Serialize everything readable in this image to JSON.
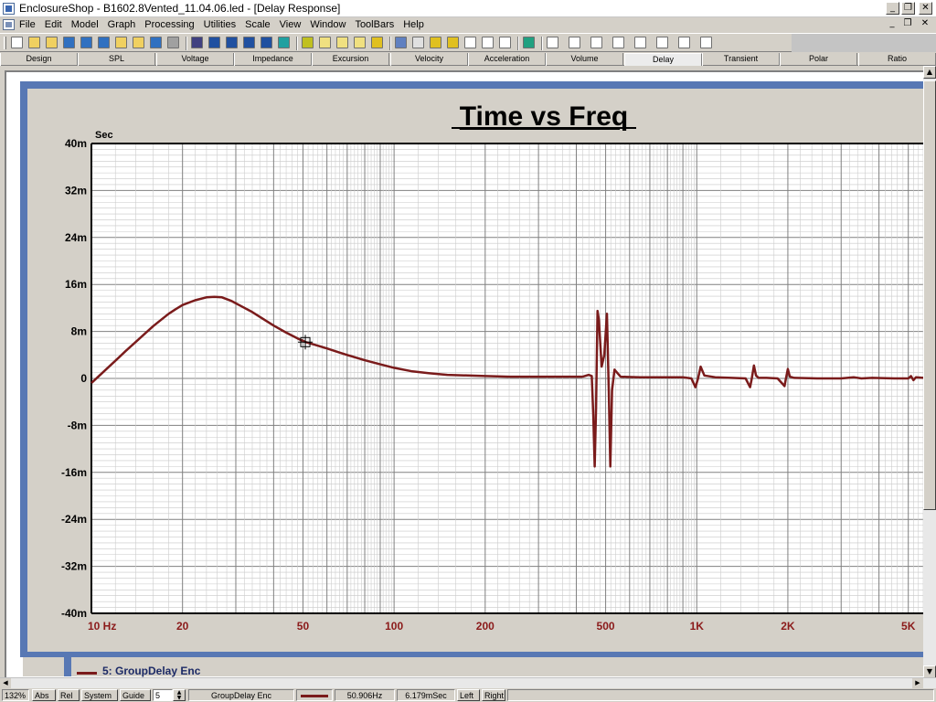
{
  "window": {
    "title": "EnclosureShop - B1602.8Vented_11.04.06.led - [Delay Response]"
  },
  "menu": [
    "File",
    "Edit",
    "Model",
    "Graph",
    "Processing",
    "Utilities",
    "Scale",
    "View",
    "Window",
    "ToolBars",
    "Help"
  ],
  "toolbar": {
    "icons": [
      "new-icon",
      "open-icon",
      "open-folder-icon",
      "save-icon",
      "save-as-icon",
      "save-all-icon",
      "folder-icon",
      "folder-open-icon",
      "save-disk-icon",
      "print-icon",
      "monitor-icon",
      "zoom-in-icon",
      "zoom-out-icon",
      "zoom-fit-icon",
      "zoom-region-icon",
      "grid-icon",
      "speaker-icon",
      "copy-icon",
      "export-icon",
      "graph-icon",
      "chart-icon",
      "bars-icon",
      "table-icon",
      "box-icon",
      "star-icon",
      "window-icon",
      "list-icon",
      "cascade-icon",
      "undo-icon",
      "brackets-icon",
      "mark-icon",
      "x-icon",
      "stack-icon",
      "multi-icon",
      "grid2-icon",
      "columns-icon",
      "panel-icon"
    ],
    "button_colors": [
      "#ffffff",
      "#f0d060",
      "#f0d060",
      "#3070c0",
      "#3070c0",
      "#3070c0",
      "#f0d060",
      "#f0d060",
      "#3070c0",
      "#a0a0a0",
      "#404080",
      "#2050a0",
      "#2050a0",
      "#2050a0",
      "#2050a0",
      "#20a0a0",
      "#c0c020",
      "#f0e080",
      "#f0e080",
      "#f0e080",
      "#e0c020",
      "#6080c0",
      "#e0e0e0",
      "#e0c020",
      "#e0c020",
      "#ffffff",
      "#ffffff",
      "#ffffff",
      "#20a080",
      "#ffffff",
      "#ffffff",
      "#ffffff",
      "#ffffff",
      "#ffffff",
      "#ffffff",
      "#ffffff",
      "#ffffff"
    ]
  },
  "tabs": [
    {
      "label": "Design",
      "active": false
    },
    {
      "label": "SPL",
      "active": false
    },
    {
      "label": "Voltage",
      "active": false
    },
    {
      "label": "Impedance",
      "active": false
    },
    {
      "label": "Excursion",
      "active": false
    },
    {
      "label": "Velocity",
      "active": false
    },
    {
      "label": "Acceleration",
      "active": false
    },
    {
      "label": "Volume",
      "active": false
    },
    {
      "label": "Delay",
      "active": true
    },
    {
      "label": "Transient",
      "active": false
    },
    {
      "label": "Polar",
      "active": false
    },
    {
      "label": "Ratio",
      "active": false
    }
  ],
  "legend": {
    "label": "5: GroupDelay Enc",
    "color": "#7a1b1b"
  },
  "statusbar": {
    "zoom": "132%",
    "abs": "Abs",
    "rel": "Rel",
    "system": "System",
    "guide": "Guide",
    "guide_value": "5",
    "trace_name": "GroupDelay Enc",
    "frequency": "50.906Hz",
    "value": "6.179mSec",
    "left": "Left",
    "right": "Right"
  },
  "chart_data": {
    "type": "line",
    "title": "Time vs Freq",
    "ylabel": "Sec",
    "xscale": "log",
    "xlim": [
      10,
      5600
    ],
    "ylim": [
      -0.04,
      0.04
    ],
    "yticks": [
      {
        "v": 0.04,
        "label": "40m"
      },
      {
        "v": 0.032,
        "label": "32m"
      },
      {
        "v": 0.024,
        "label": "24m"
      },
      {
        "v": 0.016,
        "label": "16m"
      },
      {
        "v": 0.008,
        "label": "8m"
      },
      {
        "v": 0,
        "label": "0"
      },
      {
        "v": -0.008,
        "label": "-8m"
      },
      {
        "v": -0.016,
        "label": "-16m"
      },
      {
        "v": -0.024,
        "label": "-24m"
      },
      {
        "v": -0.032,
        "label": "-32m"
      },
      {
        "v": -0.04,
        "label": "-40m"
      }
    ],
    "xticks": [
      {
        "v": 10,
        "label": "10  Hz"
      },
      {
        "v": 20,
        "label": "20"
      },
      {
        "v": 50,
        "label": "50"
      },
      {
        "v": 100,
        "label": "100"
      },
      {
        "v": 200,
        "label": "200"
      },
      {
        "v": 500,
        "label": "500"
      },
      {
        "v": 1000,
        "label": "1K"
      },
      {
        "v": 2000,
        "label": "2K"
      },
      {
        "v": 5000,
        "label": "5K"
      }
    ],
    "grid": true,
    "series": [
      {
        "name": "5: GroupDelay Enc",
        "color": "#7a1b1b",
        "x": [
          10,
          11,
          12,
          13,
          14,
          15,
          16,
          17,
          18,
          19,
          20,
          22,
          24,
          25.5,
          27,
          29,
          31,
          34,
          37,
          40,
          44,
          48,
          51,
          55,
          60,
          66,
          72,
          80,
          90,
          100,
          115,
          130,
          150,
          175,
          200,
          240,
          280,
          330,
          380,
          420,
          440,
          450,
          455,
          460,
          465,
          470,
          475,
          485,
          495,
          505,
          512,
          518,
          525,
          535,
          560,
          650,
          800,
          900,
          960,
          990,
          1010,
          1030,
          1060,
          1150,
          1300,
          1450,
          1500,
          1520,
          1545,
          1570,
          1600,
          1700,
          1850,
          1950,
          1975,
          2000,
          2030,
          2100,
          2500,
          3000,
          3300,
          3500,
          3800,
          4500,
          5000,
          5100,
          5200,
          5300,
          5600
        ],
        "y": [
          -0.0008,
          0.0012,
          0.003,
          0.0047,
          0.0062,
          0.0076,
          0.0089,
          0.01,
          0.011,
          0.0118,
          0.0125,
          0.0133,
          0.0138,
          0.0139,
          0.0138,
          0.0132,
          0.0124,
          0.0113,
          0.0101,
          0.009,
          0.0078,
          0.0068,
          0.0062,
          0.0057,
          0.0051,
          0.0044,
          0.0038,
          0.0031,
          0.0024,
          0.0018,
          0.0012,
          0.0009,
          0.0006,
          0.0005,
          0.0004,
          0.0003,
          0.0003,
          0.0003,
          0.0003,
          0.0003,
          0.0006,
          0.0004,
          -0.006,
          -0.015,
          -0.005,
          0.0115,
          0.01,
          0.002,
          0.004,
          0.011,
          -0.002,
          -0.015,
          -0.002,
          0.0015,
          0.0003,
          0.0002,
          0.0002,
          0.0002,
          0.0,
          -0.0015,
          0.0,
          0.002,
          0.0005,
          0.0002,
          0.0001,
          0.0,
          -0.0015,
          0.0,
          0.0022,
          0.0005,
          0.0001,
          0.0001,
          0.0,
          -0.0013,
          0.0002,
          0.0016,
          0.0003,
          0.0001,
          0.0,
          0.0,
          0.0002,
          0.0,
          0.0001,
          0.0,
          0.0,
          0.0004,
          -0.0003,
          0.0002,
          0.0001
        ]
      }
    ]
  }
}
